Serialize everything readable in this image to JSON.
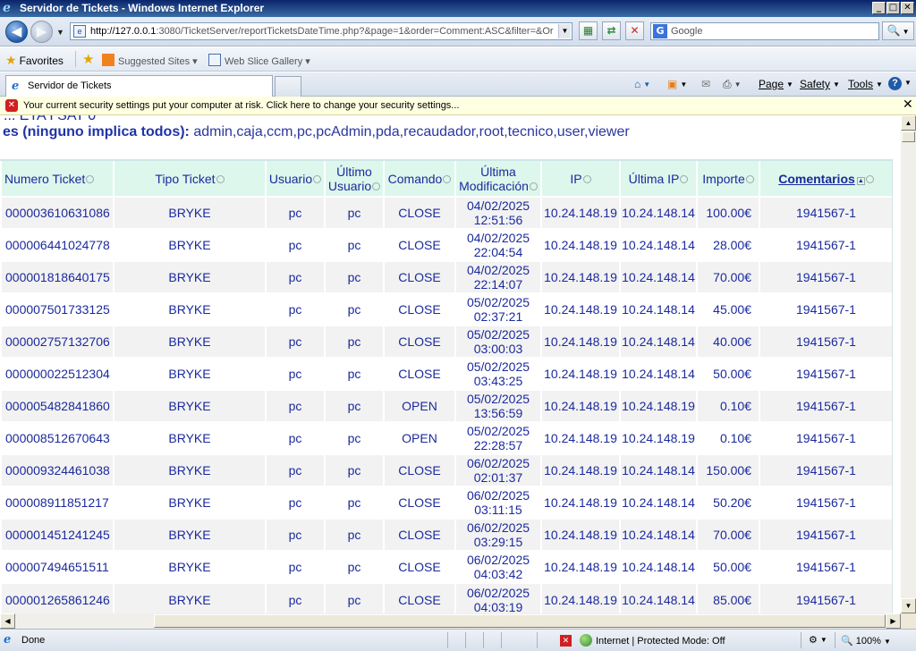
{
  "window": {
    "title": "Servidor de Tickets - Windows Internet Explorer"
  },
  "nav": {
    "url_host": "http://127.0.0.1",
    "url_rest": ":3080/TicketServer/reportTicketsDateTime.php?&page=1&order=Comment:ASC&filter=&Or",
    "search_placeholder": "Google"
  },
  "favorites_bar": {
    "favorites_label": "Favorites",
    "items": [
      "Suggested Sites",
      "Web Slice Gallery"
    ]
  },
  "tab": {
    "title": "Servidor de Tickets"
  },
  "commands": {
    "page": "Page",
    "safety": "Safety",
    "tools": "Tools"
  },
  "infobar": {
    "message": "Your current security settings put your computer at risk. Click here to change your security settings..."
  },
  "page": {
    "cut_heading": "... ETA I SAT 0",
    "filter_label": "es (ninguno implica todos):",
    "filter_values": "admin,caja,ccm,pc,pcAdmin,pda,recaudador,root,tecnico,user,viewer"
  },
  "table": {
    "headers": {
      "numero": "Numero Ticket",
      "tipo": "Tipo Ticket",
      "usuario": "Usuario",
      "ultimo_usuario": "Último Usuario",
      "comando": "Comando",
      "modificacion": "Última Modificación",
      "ip": "IP",
      "ultima_ip": "Última IP",
      "importe": "Importe",
      "comentarios": "Comentarios"
    },
    "rows": [
      {
        "numero": "000003610631086",
        "tipo": "BRYKE",
        "usuario": "pc",
        "ultimo": "pc",
        "comando": "CLOSE",
        "fecha": "04/02/2025",
        "hora": "12:51:56",
        "ip": "10.24.148.19",
        "ultima_ip": "10.24.148.14",
        "importe": "100.00€",
        "comentario": "1941567-1"
      },
      {
        "numero": "000006441024778",
        "tipo": "BRYKE",
        "usuario": "pc",
        "ultimo": "pc",
        "comando": "CLOSE",
        "fecha": "04/02/2025",
        "hora": "22:04:54",
        "ip": "10.24.148.19",
        "ultima_ip": "10.24.148.14",
        "importe": "28.00€",
        "comentario": "1941567-1"
      },
      {
        "numero": "000001818640175",
        "tipo": "BRYKE",
        "usuario": "pc",
        "ultimo": "pc",
        "comando": "CLOSE",
        "fecha": "04/02/2025",
        "hora": "22:14:07",
        "ip": "10.24.148.19",
        "ultima_ip": "10.24.148.14",
        "importe": "70.00€",
        "comentario": "1941567-1"
      },
      {
        "numero": "000007501733125",
        "tipo": "BRYKE",
        "usuario": "pc",
        "ultimo": "pc",
        "comando": "CLOSE",
        "fecha": "05/02/2025",
        "hora": "02:37:21",
        "ip": "10.24.148.19",
        "ultima_ip": "10.24.148.14",
        "importe": "45.00€",
        "comentario": "1941567-1"
      },
      {
        "numero": "000002757132706",
        "tipo": "BRYKE",
        "usuario": "pc",
        "ultimo": "pc",
        "comando": "CLOSE",
        "fecha": "05/02/2025",
        "hora": "03:00:03",
        "ip": "10.24.148.19",
        "ultima_ip": "10.24.148.14",
        "importe": "40.00€",
        "comentario": "1941567-1"
      },
      {
        "numero": "000000022512304",
        "tipo": "BRYKE",
        "usuario": "pc",
        "ultimo": "pc",
        "comando": "CLOSE",
        "fecha": "05/02/2025",
        "hora": "03:43:25",
        "ip": "10.24.148.19",
        "ultima_ip": "10.24.148.14",
        "importe": "50.00€",
        "comentario": "1941567-1"
      },
      {
        "numero": "000005482841860",
        "tipo": "BRYKE",
        "usuario": "pc",
        "ultimo": "pc",
        "comando": "OPEN",
        "fecha": "05/02/2025",
        "hora": "13:56:59",
        "ip": "10.24.148.19",
        "ultima_ip": "10.24.148.19",
        "importe": "0.10€",
        "comentario": "1941567-1"
      },
      {
        "numero": "000008512670643",
        "tipo": "BRYKE",
        "usuario": "pc",
        "ultimo": "pc",
        "comando": "OPEN",
        "fecha": "05/02/2025",
        "hora": "22:28:57",
        "ip": "10.24.148.19",
        "ultima_ip": "10.24.148.19",
        "importe": "0.10€",
        "comentario": "1941567-1"
      },
      {
        "numero": "000009324461038",
        "tipo": "BRYKE",
        "usuario": "pc",
        "ultimo": "pc",
        "comando": "CLOSE",
        "fecha": "06/02/2025",
        "hora": "02:01:37",
        "ip": "10.24.148.19",
        "ultima_ip": "10.24.148.14",
        "importe": "150.00€",
        "comentario": "1941567-1"
      },
      {
        "numero": "000008911851217",
        "tipo": "BRYKE",
        "usuario": "pc",
        "ultimo": "pc",
        "comando": "CLOSE",
        "fecha": "06/02/2025",
        "hora": "03:11:15",
        "ip": "10.24.148.19",
        "ultima_ip": "10.24.148.14",
        "importe": "50.20€",
        "comentario": "1941567-1"
      },
      {
        "numero": "000001451241245",
        "tipo": "BRYKE",
        "usuario": "pc",
        "ultimo": "pc",
        "comando": "CLOSE",
        "fecha": "06/02/2025",
        "hora": "03:29:15",
        "ip": "10.24.148.19",
        "ultima_ip": "10.24.148.14",
        "importe": "70.00€",
        "comentario": "1941567-1"
      },
      {
        "numero": "000007494651511",
        "tipo": "BRYKE",
        "usuario": "pc",
        "ultimo": "pc",
        "comando": "CLOSE",
        "fecha": "06/02/2025",
        "hora": "04:03:42",
        "ip": "10.24.148.19",
        "ultima_ip": "10.24.148.14",
        "importe": "50.00€",
        "comentario": "1941567-1"
      },
      {
        "numero": "000001265861246",
        "tipo": "BRYKE",
        "usuario": "pc",
        "ultimo": "pc",
        "comando": "CLOSE",
        "fecha": "06/02/2025",
        "hora": "04:03:19",
        "ip": "10.24.148.19",
        "ultima_ip": "10.24.148.14",
        "importe": "85.00€",
        "comentario": "1941567-1"
      }
    ]
  },
  "statusbar": {
    "status": "Done",
    "zone": "Internet | Protected Mode: Off",
    "zoom": "100%"
  }
}
